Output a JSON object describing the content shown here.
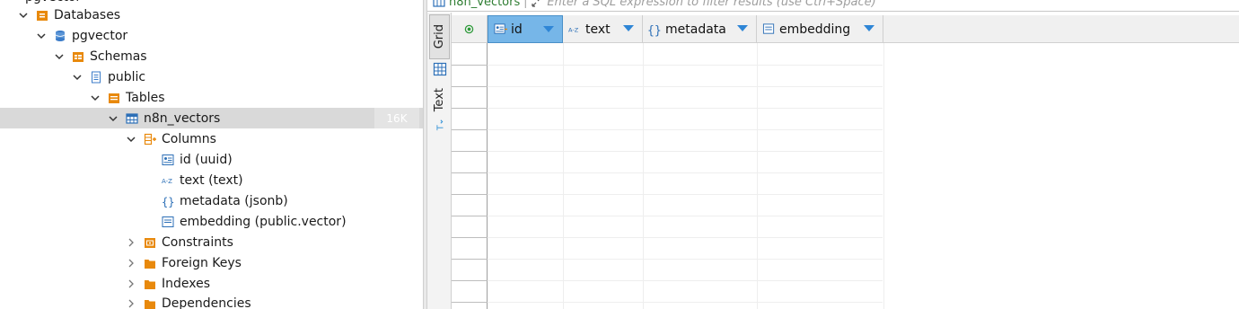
{
  "navigator": {
    "top_clipped_label": "pgvector",
    "items": [
      {
        "label": "Databases",
        "icon": "databases-folder-icon",
        "chevron": "down",
        "level": 0
      },
      {
        "label": "pgvector",
        "icon": "database-icon",
        "chevron": "down",
        "level": 1
      },
      {
        "label": "Schemas",
        "icon": "schemas-folder-icon",
        "chevron": "down",
        "level": 2
      },
      {
        "label": "public",
        "icon": "schema-icon",
        "chevron": "down",
        "level": 3
      },
      {
        "label": "Tables",
        "icon": "tables-folder-icon",
        "chevron": "down",
        "level": 4
      },
      {
        "label": "n8n_vectors",
        "icon": "table-icon",
        "chevron": "down",
        "level": 5,
        "selected": true,
        "size": "16K"
      },
      {
        "label": "Columns",
        "icon": "columns-folder-icon",
        "chevron": "down",
        "level": 6
      },
      {
        "label": "id (uuid)",
        "icon": "id-column-icon",
        "chevron": "none",
        "level": 7
      },
      {
        "label": "text (text)",
        "icon": "text-column-icon",
        "chevron": "none",
        "level": 7
      },
      {
        "label": "metadata (jsonb)",
        "icon": "json-column-icon",
        "chevron": "none",
        "level": 7
      },
      {
        "label": "embedding (public.vector)",
        "icon": "vector-column-icon",
        "chevron": "none",
        "level": 7
      },
      {
        "label": "Constraints",
        "icon": "constraints-folder-icon",
        "chevron": "right",
        "level": 6
      },
      {
        "label": "Foreign Keys",
        "icon": "folder-icon",
        "chevron": "right",
        "level": 6
      },
      {
        "label": "Indexes",
        "icon": "folder-icon",
        "chevron": "right",
        "level": 6
      },
      {
        "label": "Dependencies",
        "icon": "folder-icon",
        "chevron": "right",
        "level": 6
      }
    ]
  },
  "filter": {
    "table_name": "n8n_vectors",
    "placeholder": "Enter a SQL expression to filter results (use Ctrl+Space)"
  },
  "view_tabs": {
    "grid_label": "Grid",
    "text_label": "Text"
  },
  "grid": {
    "columns": [
      {
        "label": "id",
        "icon": "id-column-icon",
        "selected": true
      },
      {
        "label": "text",
        "icon": "text-column-icon",
        "selected": false
      },
      {
        "label": "metadata",
        "icon": "json-column-icon",
        "selected": false
      },
      {
        "label": "embedding",
        "icon": "vector-column-icon",
        "selected": false
      }
    ],
    "rows": []
  },
  "colors": {
    "folder_orange": "#e8890c",
    "selected_row": "#d9d9d9",
    "selected_header": "#76b6e8",
    "sort_arrow": "#2f86d6",
    "table_icon_blue": "#2c6fb7",
    "filter_table_green": "#2e7d32"
  }
}
